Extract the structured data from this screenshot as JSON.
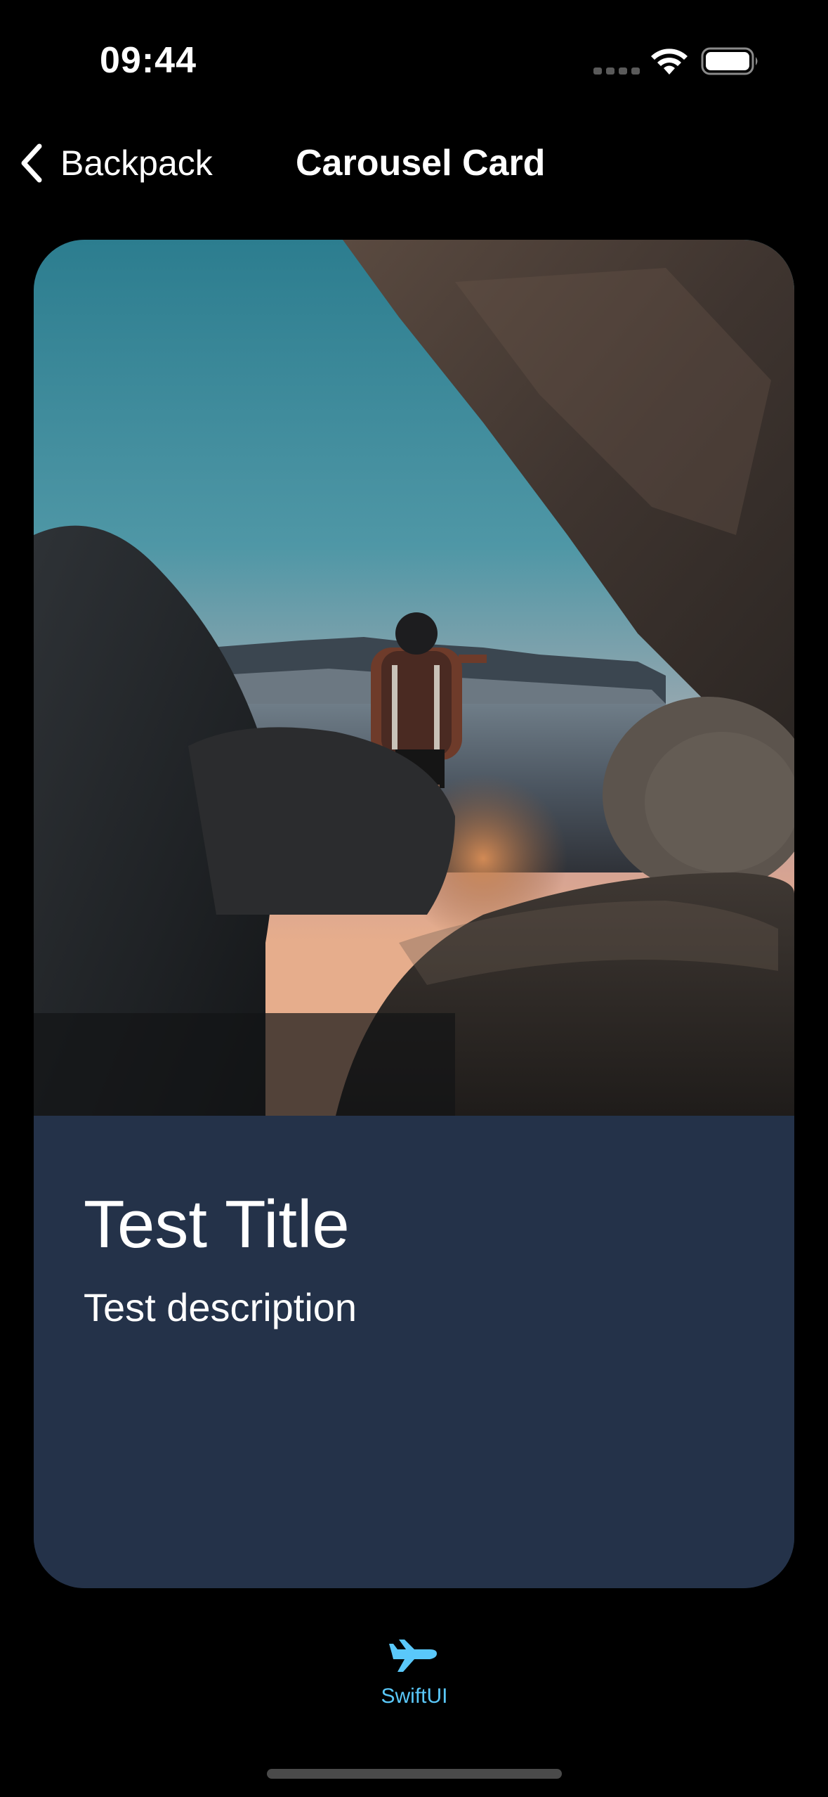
{
  "status_bar": {
    "time": "09:44",
    "icons": [
      "signal-dots-icon",
      "wifi-icon",
      "battery-icon"
    ]
  },
  "nav": {
    "back_label": "Backpack",
    "title": "Carousel Card",
    "back_icon": "chevron-left-icon"
  },
  "card": {
    "image_description_icon": "hiker-photo",
    "title": "Test Title",
    "description": "Test description",
    "body_color": "#243249"
  },
  "tab_bar": {
    "items": [
      {
        "label": "SwiftUI",
        "icon": "airplane-icon",
        "selected": true
      }
    ],
    "accent_color": "#5ac8fa"
  }
}
